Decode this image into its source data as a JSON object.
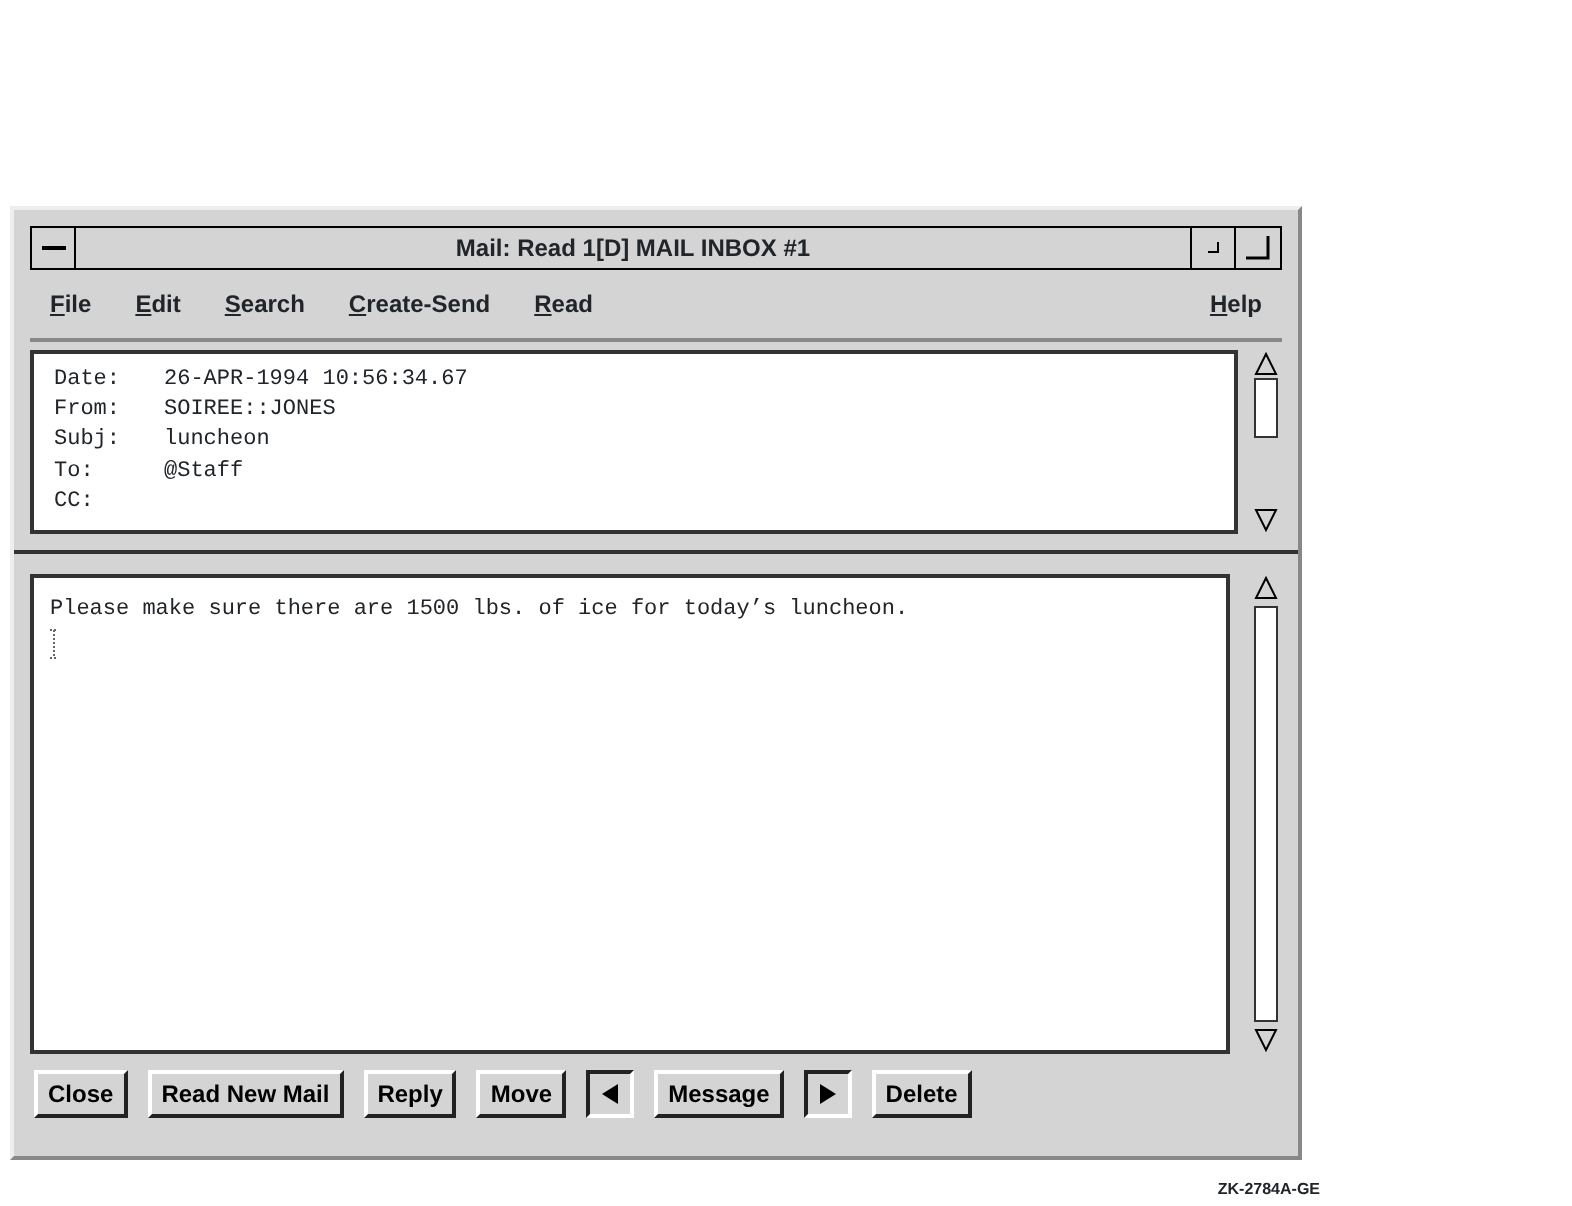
{
  "window": {
    "title": "Mail: Read 1[D] MAIL INBOX #1"
  },
  "menu": [
    {
      "label": "File"
    },
    {
      "label": "Edit"
    },
    {
      "label": "Search"
    },
    {
      "label": "Create-Send"
    },
    {
      "label": "Read"
    }
  ],
  "help_menu": {
    "label": "Help"
  },
  "header_fields": [
    {
      "label": "Date:",
      "value": "26-APR-1994 10:56:34.67"
    },
    {
      "label": "From:",
      "value": "SOIREE::JONES"
    },
    {
      "label": "Subj:",
      "value": "luncheon"
    },
    {
      "label": "To:",
      "value": "@Staff"
    },
    {
      "label": "CC:"
    }
  ],
  "body": {
    "text": "Please make sure there are 1500 lbs. of ice for today’s luncheon."
  },
  "buttons": [
    {
      "kind": "text",
      "label": "Close"
    },
    {
      "kind": "text",
      "label": "Read New Mail"
    },
    {
      "kind": "text",
      "label": "Reply"
    },
    {
      "kind": "text",
      "label": "Move"
    },
    {
      "kind": "prev"
    },
    {
      "kind": "text",
      "label": "Message"
    },
    {
      "kind": "next"
    },
    {
      "kind": "text",
      "label": "Delete"
    }
  ],
  "figure_id": "ZK-2784A-GE"
}
